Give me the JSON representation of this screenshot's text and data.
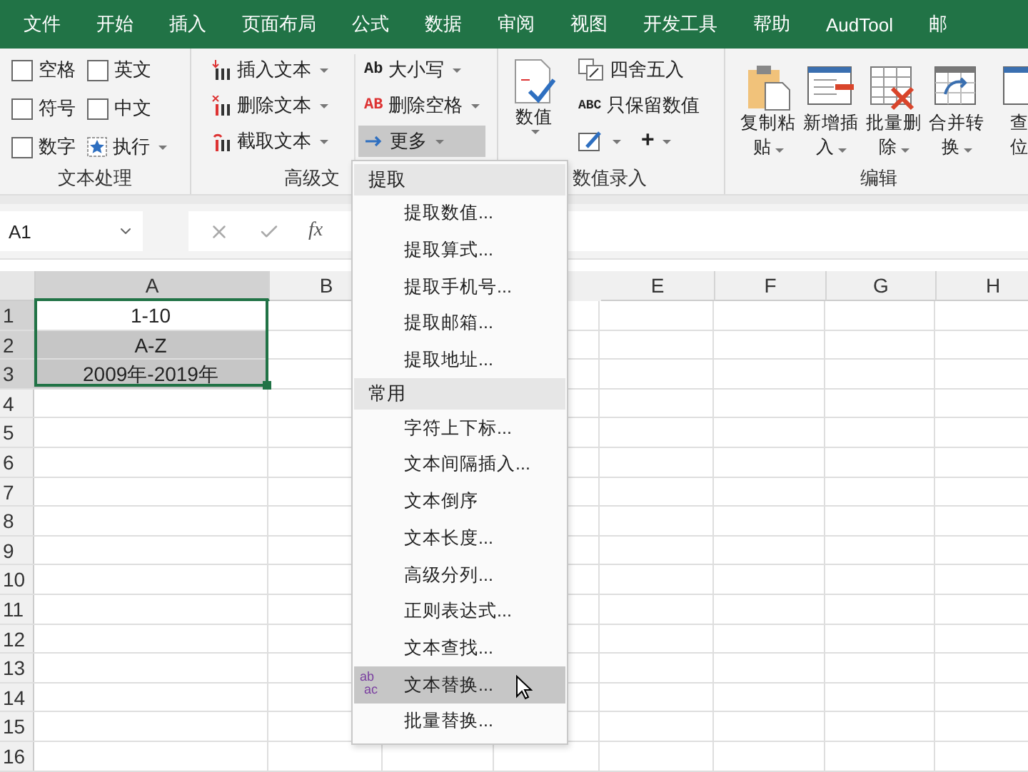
{
  "menu_tabs": [
    "文件",
    "开始",
    "插入",
    "页面布局",
    "公式",
    "数据",
    "审阅",
    "视图",
    "开发工具",
    "帮助",
    "AudTool",
    "邮"
  ],
  "ribbon": {
    "text_group": {
      "label": "文本处理",
      "checkboxes": [
        {
          "label": "空格",
          "checked": false
        },
        {
          "label": "英文",
          "checked": false
        },
        {
          "label": "符号",
          "checked": false
        },
        {
          "label": "中文",
          "checked": false
        },
        {
          "label": "数字",
          "checked": false
        }
      ],
      "run_button": "执行"
    },
    "advanced_group": {
      "label": "高级文",
      "left": [
        {
          "kind": "insert",
          "label": "插入文本"
        },
        {
          "kind": "delete",
          "label": "删除文本"
        },
        {
          "kind": "cut",
          "label": "截取文本"
        }
      ],
      "right": [
        {
          "kind": "case",
          "label": "大小写",
          "icon_text": "Ab",
          "active": false
        },
        {
          "kind": "space",
          "label": "删除空格",
          "icon_text": "AB",
          "active": false
        },
        {
          "kind": "more",
          "label": "更多",
          "active": true
        }
      ]
    },
    "number_group": {
      "label": "数值录入",
      "big_button": "数值",
      "items": [
        {
          "kind": "round",
          "label": "四舍五入"
        },
        {
          "kind": "keep",
          "label": "只保留数值",
          "icon_text": "ABC"
        }
      ],
      "plus": "+"
    },
    "edit_group": {
      "label": "编辑",
      "buttons": [
        {
          "kind": "paste",
          "lines": [
            "复制粘",
            "贴"
          ]
        },
        {
          "kind": "insert",
          "lines": [
            "新增插",
            "入"
          ]
        },
        {
          "kind": "delete",
          "lines": [
            "批量删",
            "除"
          ]
        },
        {
          "kind": "merge",
          "lines": [
            "合并转",
            "换"
          ]
        },
        {
          "kind": "find",
          "lines": [
            "查",
            "位"
          ]
        }
      ]
    }
  },
  "formula_bar": {
    "name_box": "A1",
    "fx": "fx"
  },
  "sheet": {
    "columns": [
      {
        "label": "A",
        "selected": true
      },
      {
        "label": "B",
        "selected": false
      },
      {
        "label": "E",
        "selected": false
      },
      {
        "label": "F",
        "selected": false
      },
      {
        "label": "G",
        "selected": false
      },
      {
        "label": "H",
        "selected": false
      }
    ],
    "rows": [
      {
        "number": "1",
        "selected": true,
        "cell_a": "1-10",
        "highlighted": false
      },
      {
        "number": "2",
        "selected": true,
        "cell_a": "A-Z",
        "highlighted": true
      },
      {
        "number": "3",
        "selected": true,
        "cell_a": "2009年-2019年",
        "highlighted": true
      },
      {
        "number": "4",
        "selected": false
      },
      {
        "number": "5",
        "selected": false
      },
      {
        "number": "6",
        "selected": false
      },
      {
        "number": "7",
        "selected": false
      },
      {
        "number": "8",
        "selected": false
      },
      {
        "number": "9",
        "selected": false
      },
      {
        "number": "10",
        "selected": false
      },
      {
        "number": "11",
        "selected": false
      },
      {
        "number": "12",
        "selected": false
      },
      {
        "number": "13",
        "selected": false
      },
      {
        "number": "14",
        "selected": false
      },
      {
        "number": "15",
        "selected": false
      },
      {
        "number": "16",
        "selected": false
      }
    ]
  },
  "dropdown": {
    "sections": [
      {
        "heading": "提取",
        "items": [
          {
            "label": "提取数值...",
            "selected": false
          },
          {
            "label": "提取算式...",
            "selected": false
          },
          {
            "label": "提取手机号...",
            "selected": false
          },
          {
            "label": "提取邮箱...",
            "selected": false
          },
          {
            "label": "提取地址...",
            "selected": false
          }
        ]
      },
      {
        "heading": "常用",
        "items": [
          {
            "label": "字符上下标...",
            "selected": false
          },
          {
            "label": "文本间隔插入...",
            "selected": false
          },
          {
            "label": "文本倒序",
            "selected": false
          },
          {
            "label": "文本长度...",
            "selected": false
          },
          {
            "label": "高级分列...",
            "selected": false
          },
          {
            "label": "正则表达式...",
            "selected": false
          },
          {
            "label": "文本查找...",
            "selected": false
          },
          {
            "label": "文本替换...",
            "selected": true,
            "icon_top": "ab",
            "icon_bottom": "ac"
          },
          {
            "label": "批量替换...",
            "selected": false
          }
        ]
      }
    ]
  }
}
